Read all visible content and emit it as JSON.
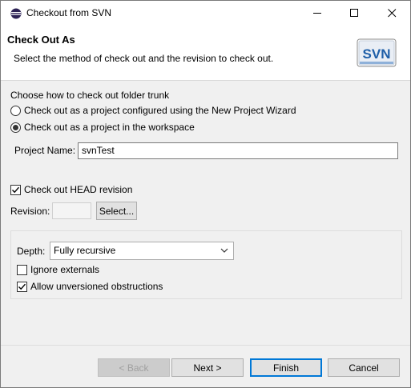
{
  "window": {
    "title": "Checkout from SVN"
  },
  "banner": {
    "title": "Check Out As",
    "description": "Select the method of check out and the revision to check out.",
    "logo_text": "SVN"
  },
  "checkout_method": {
    "group_label": "Choose how to check out folder trunk",
    "option_wizard": "Check out as a project configured using the New Project Wizard",
    "option_workspace": "Check out as a project in the workspace",
    "selected": "option_workspace"
  },
  "project": {
    "label": "Project Name:",
    "value": "svnTest"
  },
  "revision": {
    "head_label": "Check out HEAD revision",
    "head_checked": true,
    "revision_label": "Revision:",
    "revision_value": "",
    "select_button": "Select..."
  },
  "depth": {
    "label": "Depth:",
    "value": "Fully recursive",
    "ignore_externals_label": "Ignore externals",
    "ignore_externals_checked": false,
    "allow_unversioned_label": "Allow unversioned obstructions",
    "allow_unversioned_checked": true
  },
  "buttons": {
    "back": "< Back",
    "next": "Next >",
    "finish": "Finish",
    "cancel": "Cancel"
  },
  "colors": {
    "accent": "#0078d7",
    "svn_blue": "#1f5fa8"
  }
}
